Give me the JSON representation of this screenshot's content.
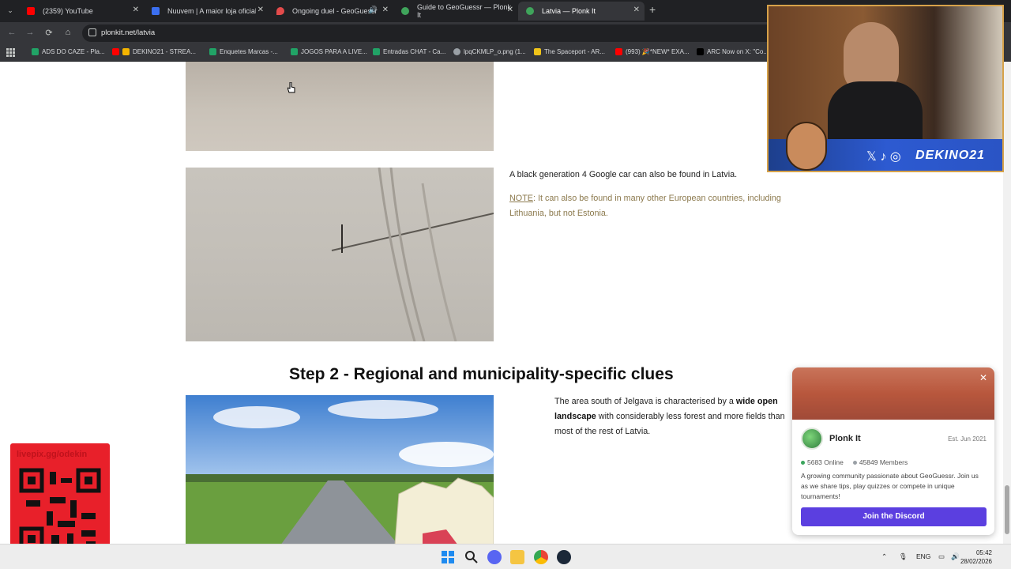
{
  "browser": {
    "tabs": [
      {
        "label": "(2359) YouTube",
        "color": "#ff0000"
      },
      {
        "label": "Nuuvem | A maior loja oficial d",
        "color": "#3b6ff0"
      },
      {
        "label": "Ongoing duel - GeoGuessr",
        "color": "#e34b4b"
      },
      {
        "label": "Guide to GeoGuessr — Plonk It",
        "color": "#3fa45b"
      },
      {
        "label": "Latvia — Plonk It",
        "color": "#3fa45b"
      }
    ],
    "url": "plonkit.net/latvia",
    "bookmarks": [
      {
        "label": "ADS DO CAZE - Pla...",
        "color": "#21a366"
      },
      {
        "label": "DEKINO21 - STREA...",
        "color": "#f4b400"
      },
      {
        "label": "Enquetes Marcas -...",
        "color": "#21a366"
      },
      {
        "label": "JOGOS PARA A LIVE...",
        "color": "#21a366"
      },
      {
        "label": "Entradas CHAT - Ca...",
        "color": "#21a366"
      },
      {
        "label": "lpqCKMLP_o.png (1...",
        "color": "#9aa0a6"
      },
      {
        "label": "The Spaceport - AR...",
        "color": "#f0c419"
      },
      {
        "label": "(993) 🎉*NEW* EXA...",
        "color": "#ff0000"
      },
      {
        "label": "ARC Now on X: \"Co...",
        "color": "#000000"
      }
    ]
  },
  "page": {
    "gen4_text": "A black generation 4 Google car can also be found in Latvia.",
    "note_label": "NOTE",
    "note_text": ": It can also be found in many other European countries, including Lithuania, but not Estonia.",
    "heading": "Step 2 - Regional and municipality-specific clues",
    "para_start": "The area south of Jelgava is characterised by a ",
    "para_bold": "wide open landscape",
    "para_end": " with considerably less forest and more fields than most of the rest of Latvia."
  },
  "stream": {
    "handle": "DEKINO21",
    "pix_label": "livepix.gg/odekin"
  },
  "discord": {
    "name": "Plonk It",
    "est": "Est. Jun 2021",
    "online": "5683 Online",
    "members": "45849 Members",
    "description": "A growing community passionate about GeoGuessr. Join us as we share tips, play quizzes or compete in unique tournaments!",
    "join": "Join the Discord",
    "online_color": "#3ba55d",
    "members_color": "#9aa0a6"
  },
  "taskbar": {
    "lang": "ENG",
    "time": "05:42",
    "date": "28/02/2026"
  }
}
